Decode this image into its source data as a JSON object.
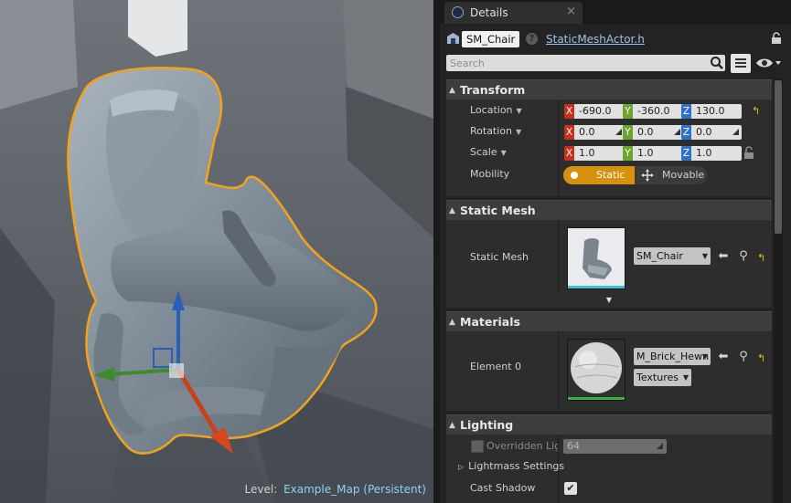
{
  "viewport": {
    "level_label": "Level:",
    "level_name": "Example_Map (Persistent)"
  },
  "details": {
    "tab_title": "Details",
    "tab_close": "×",
    "actor_name": "SM_Chair",
    "help": "?",
    "source_link": "StaticMeshActor.h",
    "search_placeholder": "Search"
  },
  "transform": {
    "title": "Transform",
    "location": {
      "label": "Location",
      "x": "-690.0",
      "y": "-360.0",
      "z": "130.0"
    },
    "rotation": {
      "label": "Rotation",
      "x": "0.0",
      "y": "0.0",
      "z": "0.0"
    },
    "scale": {
      "label": "Scale",
      "x": "1.0",
      "y": "1.0",
      "z": "1.0"
    },
    "axis_x": "X",
    "axis_y": "Y",
    "axis_z": "Z",
    "mobility": {
      "label": "Mobility",
      "static": "Static",
      "movable": "Movable",
      "selected": "Static"
    }
  },
  "static_mesh": {
    "title": "Static Mesh",
    "label": "Static Mesh",
    "value": "SM_Chair"
  },
  "materials": {
    "title": "Materials",
    "element_label": "Element 0",
    "value": "M_Brick_Hewn",
    "textures_label": "Textures"
  },
  "lighting": {
    "title": "Lighting",
    "overridden_label": "Overridden Light",
    "overridden_value": "64",
    "lightmass_label": "Lightmass Settings",
    "cast_shadow_label": "Cast Shadow",
    "cast_shadow_checked": true
  },
  "colors": {
    "selection_outline": "#f2a31b",
    "accent_static": "#d6920f",
    "axis_x": "#c8301d",
    "axis_y": "#6ba52d",
    "axis_z": "#2f6fcd"
  }
}
